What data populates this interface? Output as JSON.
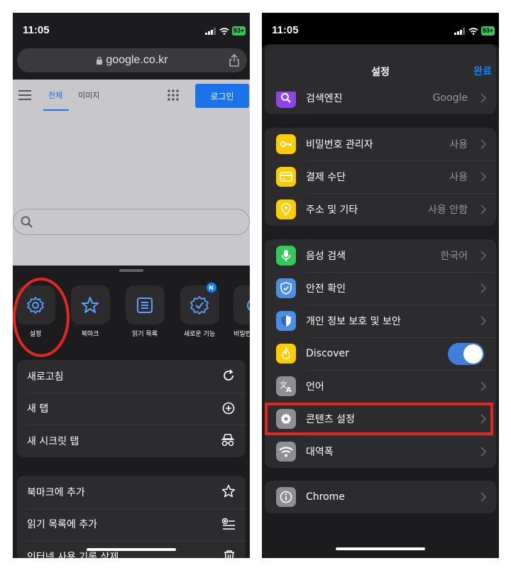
{
  "status": {
    "time": "11:05",
    "battery": "93+"
  },
  "left": {
    "url": "google.co.kr",
    "google_nav": {
      "tab_all": "전체",
      "tab_images": "이미지",
      "login": "로그인"
    },
    "actions": [
      {
        "label": "설정",
        "icon": "gear-icon"
      },
      {
        "label": "북마크",
        "icon": "star-icon"
      },
      {
        "label": "읽기 목록",
        "icon": "reading-list-icon"
      },
      {
        "label": "새로운 기능",
        "icon": "new-features-icon",
        "badge": "N"
      },
      {
        "label": "비밀번",
        "icon": "password-icon"
      }
    ],
    "menu_group_1": [
      {
        "label": "새로고침",
        "icon": "reload-icon"
      },
      {
        "label": "새 탭",
        "icon": "plus-circle-icon"
      },
      {
        "label": "새 시크릿 탭",
        "icon": "incognito-icon"
      }
    ],
    "menu_group_2": [
      {
        "label": "북마크에 추가",
        "icon": "star-outline-icon"
      },
      {
        "label": "읽기 목록에 추가",
        "icon": "add-reading-list-icon"
      },
      {
        "label": "인터넷 사용 기록 삭제",
        "icon": "trash-icon"
      }
    ]
  },
  "right": {
    "title": "설정",
    "done": "완료",
    "group_0": [
      {
        "label": "검색엔진",
        "value": "Google",
        "icon": "search-icon",
        "color": "#8e44e8"
      }
    ],
    "group_1": [
      {
        "label": "비밀번호 관리자",
        "value": "사용",
        "icon": "key-icon",
        "color": "#ffcc00"
      },
      {
        "label": "결제 수단",
        "value": "사용",
        "icon": "credit-card-icon",
        "color": "#ffcc00"
      },
      {
        "label": "주소 및 기타",
        "value": "사용 안함",
        "icon": "location-pin-icon",
        "color": "#ffcc00"
      }
    ],
    "group_2": [
      {
        "label": "음성 검색",
        "value": "한국어",
        "icon": "microphone-icon",
        "color": "#34c759"
      },
      {
        "label": "안전 확인",
        "value": "",
        "icon": "shield-check-icon",
        "color": "#4a90e2"
      },
      {
        "label": "개인 정보 보호 및 보안",
        "value": "",
        "icon": "privacy-shield-icon",
        "color": "#4a90e2"
      },
      {
        "label": "Discover",
        "value": "",
        "icon": "discover-flame-icon",
        "color": "#ffcc00",
        "toggle": true
      },
      {
        "label": "언어",
        "value": "",
        "icon": "translate-icon",
        "color": "#8e8e93"
      },
      {
        "label": "콘텐츠 설정",
        "value": "",
        "icon": "gear-icon",
        "color": "#8e8e93"
      },
      {
        "label": "대역폭",
        "value": "",
        "icon": "wifi-icon",
        "color": "#8e8e93"
      }
    ],
    "group_3": [
      {
        "label": "Chrome",
        "value": "",
        "icon": "info-icon",
        "color": "#8e8e93"
      }
    ]
  }
}
